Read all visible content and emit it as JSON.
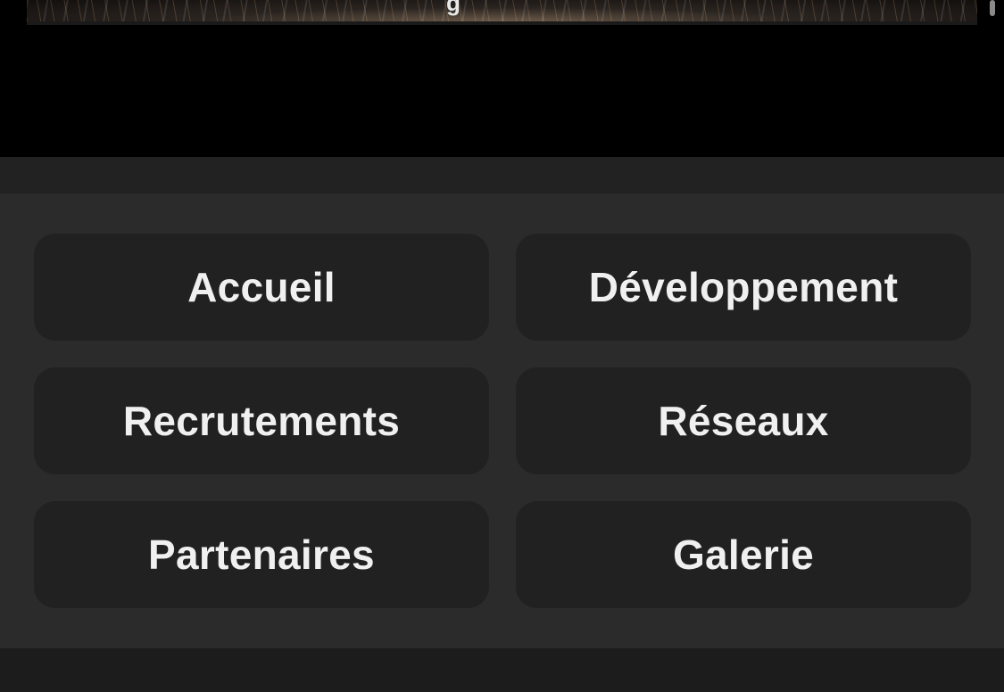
{
  "hero": {
    "glyph": "g"
  },
  "nav": {
    "items": [
      {
        "label": "Accueil"
      },
      {
        "label": "Développement"
      },
      {
        "label": "Recrutements"
      },
      {
        "label": "Réseaux"
      },
      {
        "label": "Partenaires"
      },
      {
        "label": "Galerie"
      }
    ]
  },
  "colors": {
    "background": "#000000",
    "panel": "#2b2b2b",
    "button": "#212121",
    "text": "#f0f0f0"
  }
}
